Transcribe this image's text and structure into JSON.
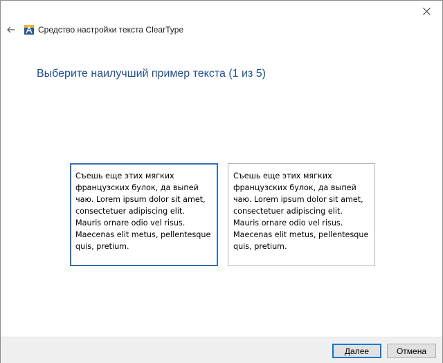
{
  "window": {
    "title": "Средство настройки текста ClearType"
  },
  "heading": "Выберите наилучший пример текста (1 из 5)",
  "samples": [
    {
      "text": "Съешь еще этих мягких французских булок, да выпей чаю. Lorem ipsum dolor sit amet, consectetuer adipiscing elit. Mauris ornare odio vel risus. Maecenas elit metus, pellentesque quis, pretium.",
      "selected": true
    },
    {
      "text": "Съешь еще этих мягких французских булок, да выпей чаю. Lorem ipsum dolor sit amet, consectetuer adipiscing elit. Mauris ornare odio vel risus. Maecenas elit metus, pellentesque quis, pretium.",
      "selected": false
    }
  ],
  "buttons": {
    "next": "Далее",
    "cancel": "Отмена"
  },
  "colors": {
    "heading": "#1f4e8c",
    "selected_border": "#2f6fb5",
    "default_button_border": "#0078d7"
  },
  "icons": {
    "close": "close-icon",
    "back": "back-arrow-icon",
    "app": "cleartype-app-icon"
  }
}
